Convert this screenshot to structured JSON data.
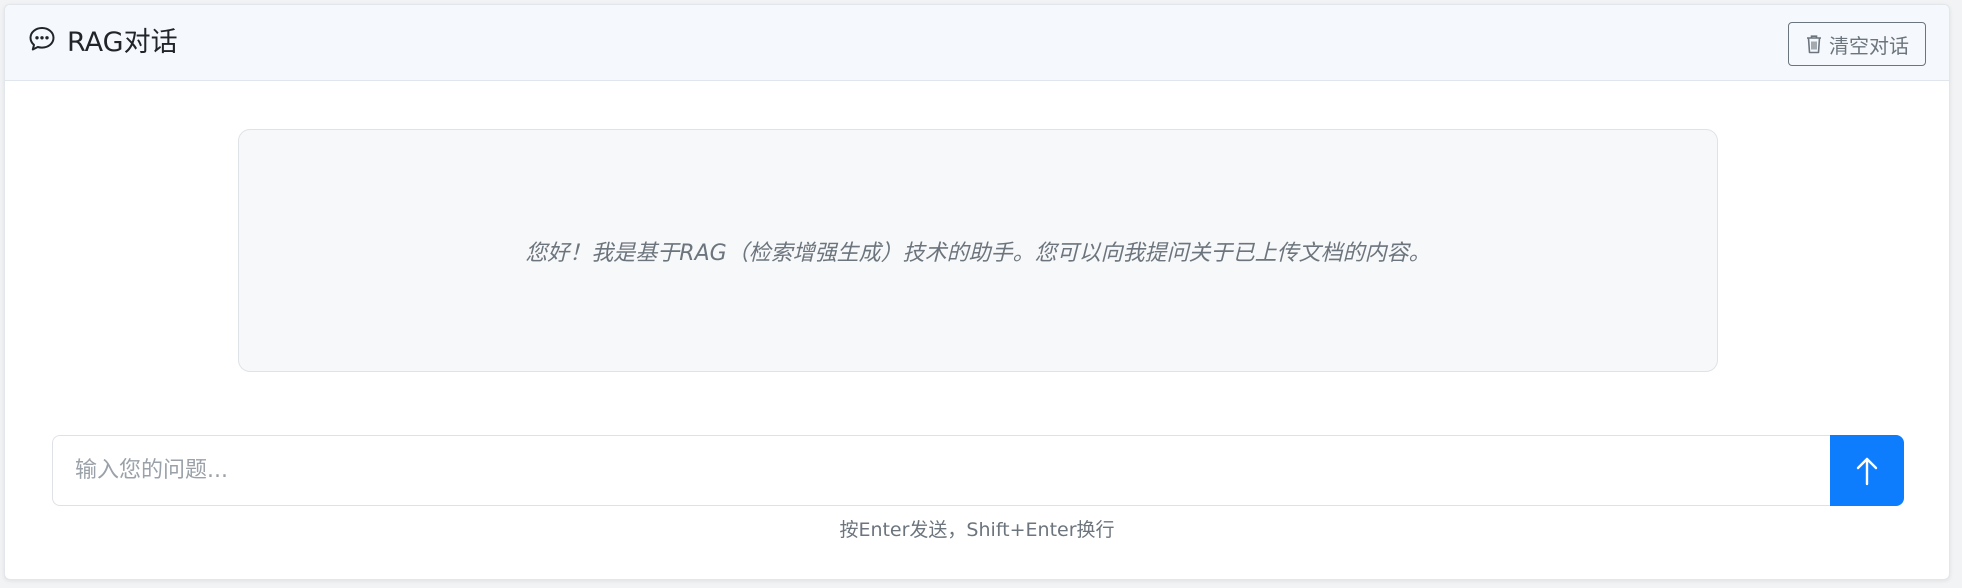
{
  "header": {
    "title": "RAG对话",
    "title_icon": "chat-bubble-icon",
    "clear_button": {
      "label": "清空对话",
      "icon": "trash-icon"
    }
  },
  "welcome": {
    "message": "您好！我是基于RAG（检索增强生成）技术的助手。您可以向我提问关于已上传文档的内容。"
  },
  "input": {
    "placeholder": "输入您的问题...",
    "value": "",
    "send_icon": "arrow-up-icon"
  },
  "hint": "按Enter发送，Shift+Enter换行",
  "colors": {
    "header_bg": "#f5f9fd",
    "primary": "#0d7dfd",
    "muted": "#6c757d",
    "welcome_bg": "#f7f8f9"
  }
}
